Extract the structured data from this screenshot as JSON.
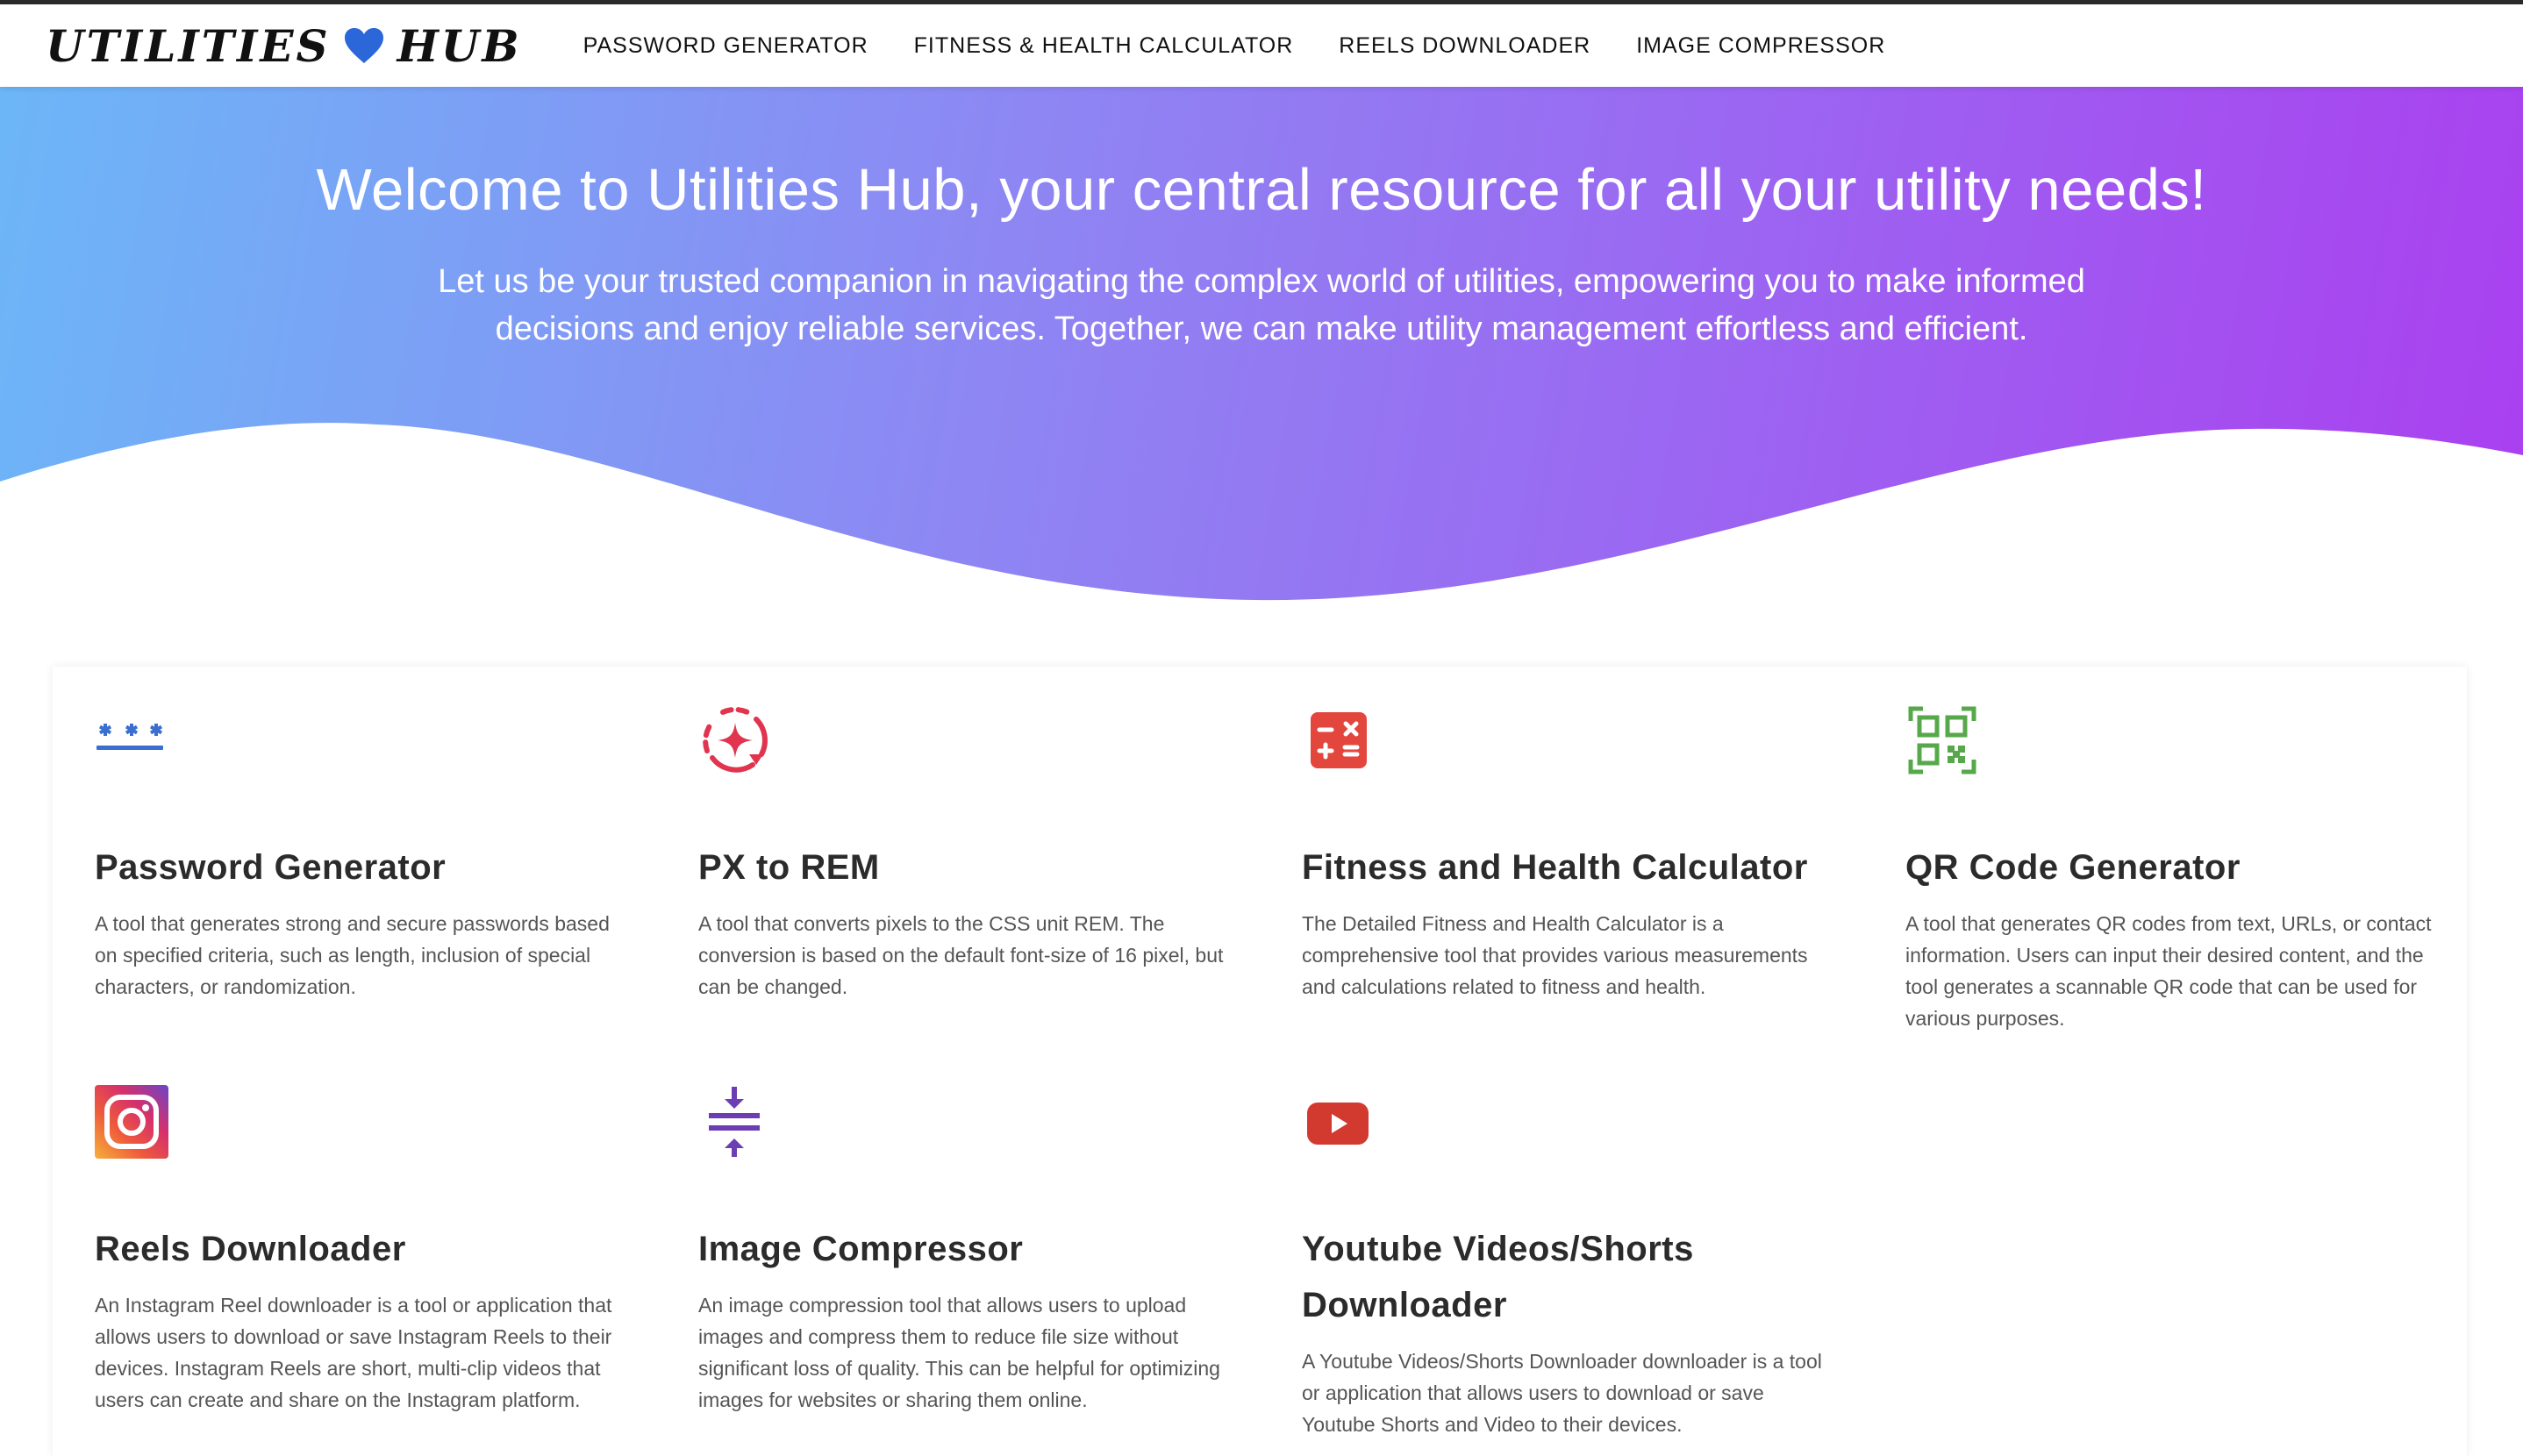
{
  "brand": {
    "name_left": "Utilities",
    "name_right": "Hub",
    "heart_color": "#2b67d8"
  },
  "nav": {
    "items": [
      {
        "label": "PASSWORD GENERATOR"
      },
      {
        "label": "FITNESS & HEALTH CALCULATOR"
      },
      {
        "label": "REELS DOWNLOADER"
      },
      {
        "label": "IMAGE COMPRESSOR"
      }
    ]
  },
  "hero": {
    "title": "Welcome to Utilities Hub, your central resource for all your utility needs!",
    "subtitle": "Let us be your trusted companion in navigating the complex world of utilities, empowering you to make informed decisions and enjoy reliable services. Together, we can make utility management effortless and efficient.",
    "gradient_colors": [
      "#6cb6f7",
      "#8e86f3",
      "#9f5df1",
      "#aa3ff0"
    ]
  },
  "tools": [
    {
      "title": "Password Generator",
      "icon": "password-asterisks-icon",
      "icon_color": "#3a6fd0",
      "description": "A tool that generates strong and secure passwords based on specified criteria, such as length, inclusion of special characters, or randomization."
    },
    {
      "title": "PX to REM",
      "icon": "sparkle-refresh-icon",
      "icon_color": "#e0344f",
      "description": "A tool that converts pixels to the CSS unit REM. The conversion is based on the default font-size of 16 pixel, but can be changed."
    },
    {
      "title": "Fitness and Health Calculator",
      "icon": "calculator-icon",
      "icon_color": "#e2463c",
      "description": "The Detailed Fitness and Health Calculator is a comprehensive tool that provides various measurements and calculations related to fitness and health."
    },
    {
      "title": "QR Code Generator",
      "icon": "qr-code-icon",
      "icon_color": "#57a84b",
      "description": "A tool that generates QR codes from text, URLs, or contact information. Users can input their desired content, and the tool generates a scannable QR code that can be used for various purposes."
    },
    {
      "title": "Reels Downloader",
      "icon": "instagram-icon",
      "icon_color": "#d6306b",
      "description": "An Instagram Reel downloader is a tool or application that allows users to download or save Instagram Reels to their devices. Instagram Reels are short, multi-clip videos that users can create and share on the Instagram platform."
    },
    {
      "title": "Image Compressor",
      "icon": "compress-arrows-icon",
      "icon_color": "#6b3fb3",
      "description": "An image compression tool that allows users to upload images and compress them to reduce file size without significant loss of quality. This can be helpful for optimizing images for websites or sharing them online."
    },
    {
      "title": "Youtube Videos/Shorts Downloader",
      "icon": "youtube-play-icon",
      "icon_color": "#d23a2f",
      "description": "A Youtube Videos/Shorts Downloader downloader is a tool or application that allows users to download or save Youtube Shorts and Video to their devices."
    }
  ]
}
